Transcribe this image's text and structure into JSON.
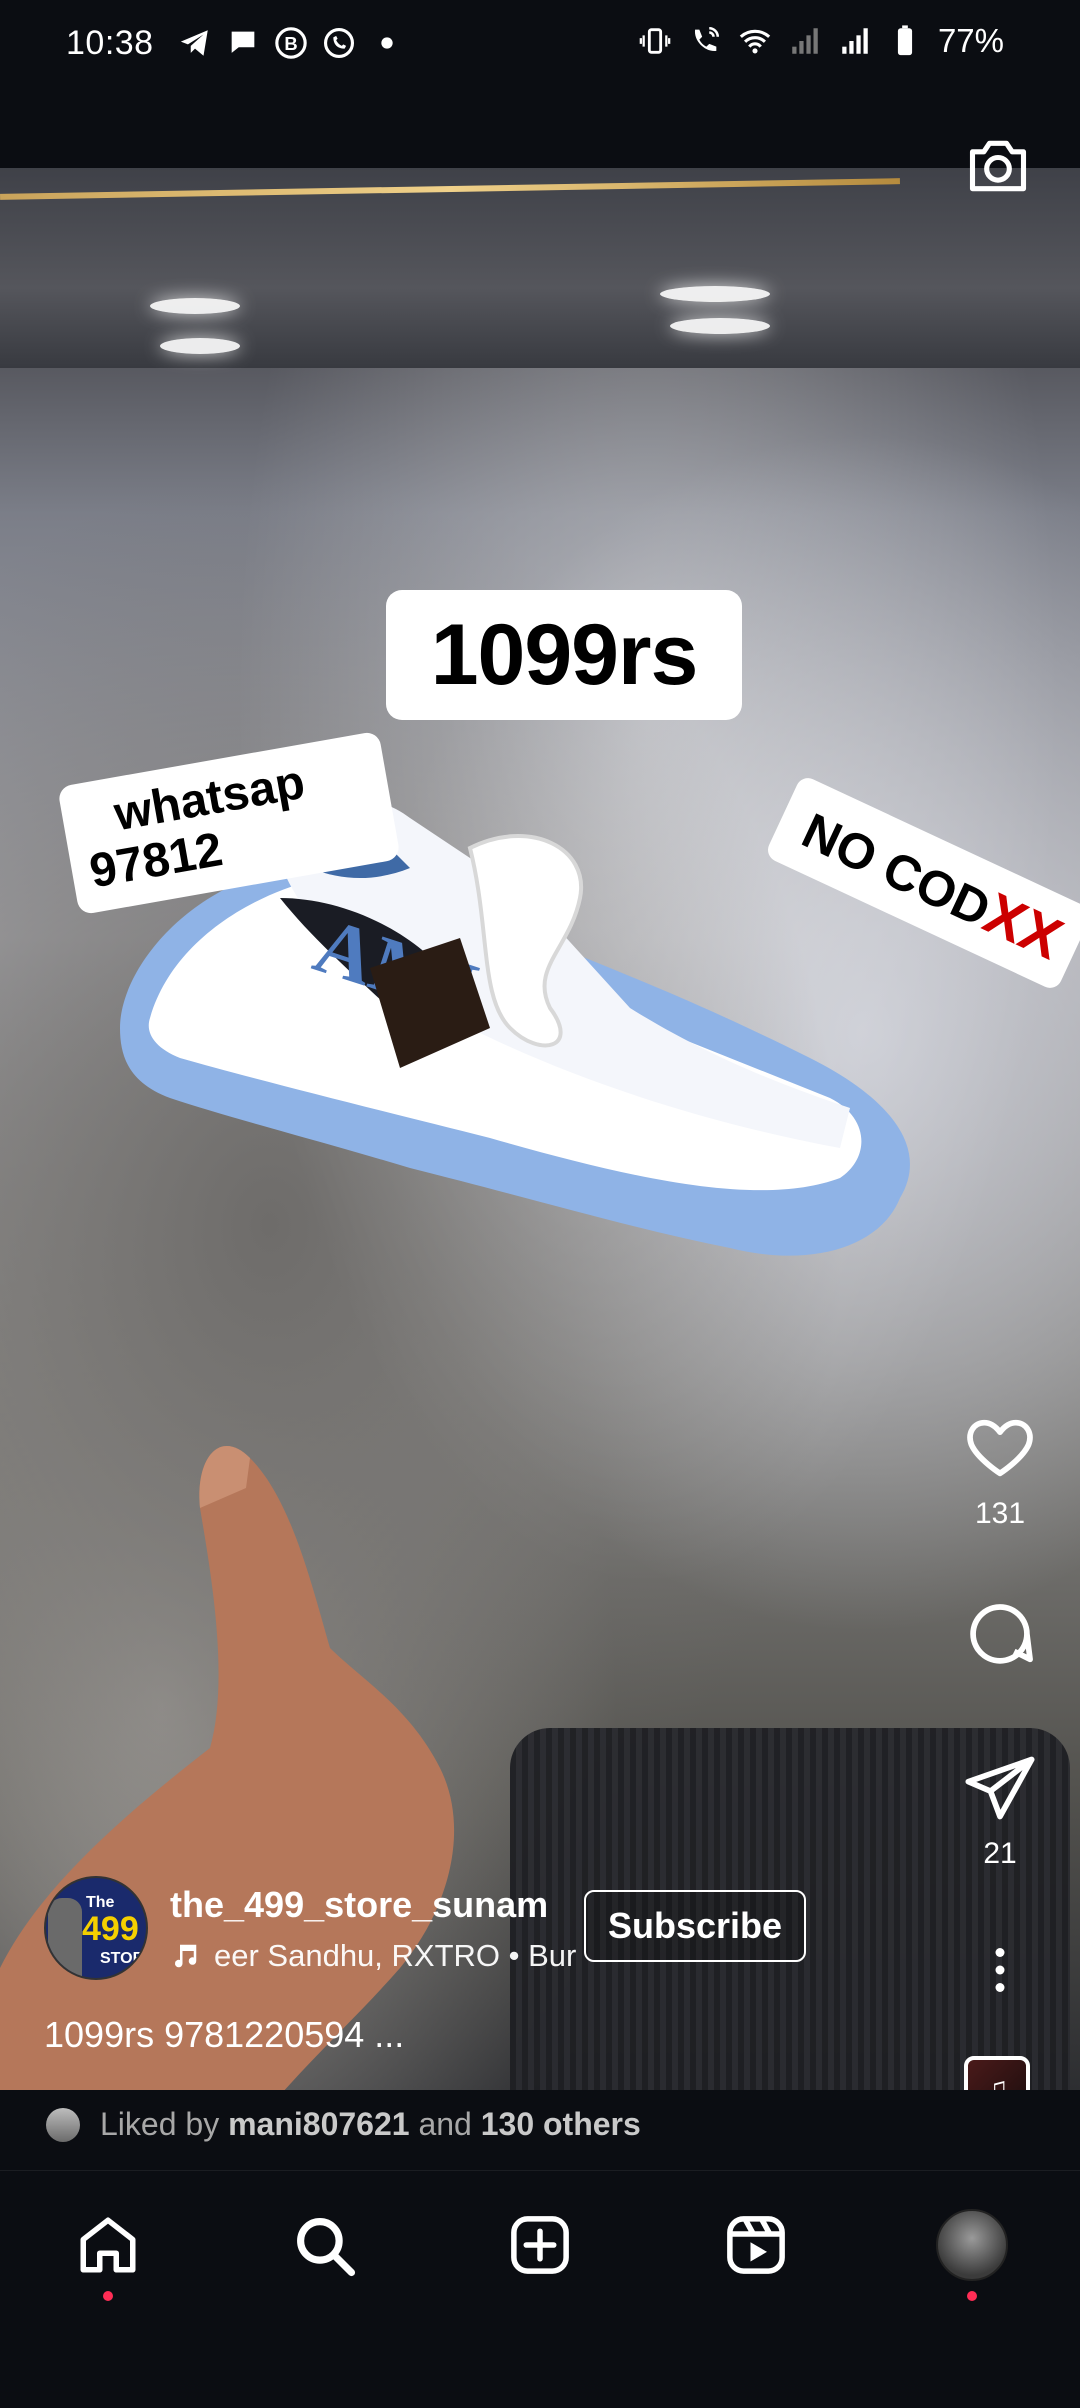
{
  "status_bar": {
    "time": "10:38",
    "battery": "77%",
    "left_icons": [
      "telegram-icon",
      "chat-icon",
      "b-icon",
      "whatsapp-icon",
      "dot-icon"
    ],
    "right_icons": [
      "vibrate-icon",
      "wifi-call-icon",
      "wifi-icon",
      "signal-icon",
      "signal-icon",
      "battery-icon"
    ]
  },
  "overlay": {
    "price": "1099rs",
    "whatsapp_line1": "whatsap",
    "whatsapp_line2": "97812",
    "no_cod": "NO COD",
    "no_cod_mark": "XX"
  },
  "actions": {
    "likes": "131",
    "shares": "21"
  },
  "author": {
    "avatar_text": [
      "The",
      "499",
      "STORE"
    ],
    "username": "the_499_store_sunam",
    "music": "eer Sandhu, RXTRO • Bur",
    "subscribe_label": "Subscribe",
    "caption": "1099rs 9781220594 ..."
  },
  "liked": {
    "prefix": "Liked by",
    "user": "mani807621",
    "middle": "and",
    "others": "130 others"
  },
  "nav": [
    "home-icon",
    "search-icon",
    "create-icon",
    "reels-icon",
    "profile-avatar"
  ],
  "colors": {
    "background": "#0b0d12",
    "accent_dot": "#ff2d55",
    "sticker_bg": "#ffffff",
    "cod_x": "#cc0000"
  }
}
